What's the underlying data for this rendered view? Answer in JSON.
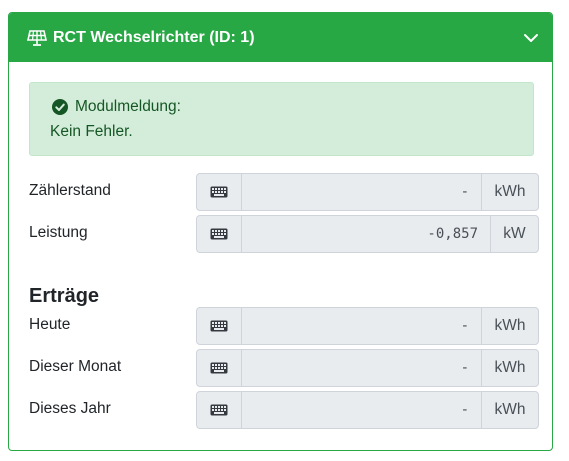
{
  "card": {
    "title": "RCT Wechselrichter (ID: 1)",
    "header_color": "#28a745"
  },
  "alert": {
    "title": "Modulmeldung:",
    "message": "Kein Fehler."
  },
  "rows_main": [
    {
      "label": "Zählerstand",
      "value": "-",
      "unit": "kWh"
    },
    {
      "label": "Leistung",
      "value": "-0,857",
      "unit": "kW"
    }
  ],
  "section_title": "Erträge",
  "rows_yield": [
    {
      "label": "Heute",
      "value": "-",
      "unit": "kWh"
    },
    {
      "label": "Dieser Monat",
      "value": "-",
      "unit": "kWh"
    },
    {
      "label": "Dieses Jahr",
      "value": "-",
      "unit": "kWh"
    }
  ],
  "icons": {
    "header": "solar-panel-icon",
    "collapse": "chevron-down-icon",
    "alert": "check-circle-icon",
    "input_prefix": "keyboard-icon"
  }
}
